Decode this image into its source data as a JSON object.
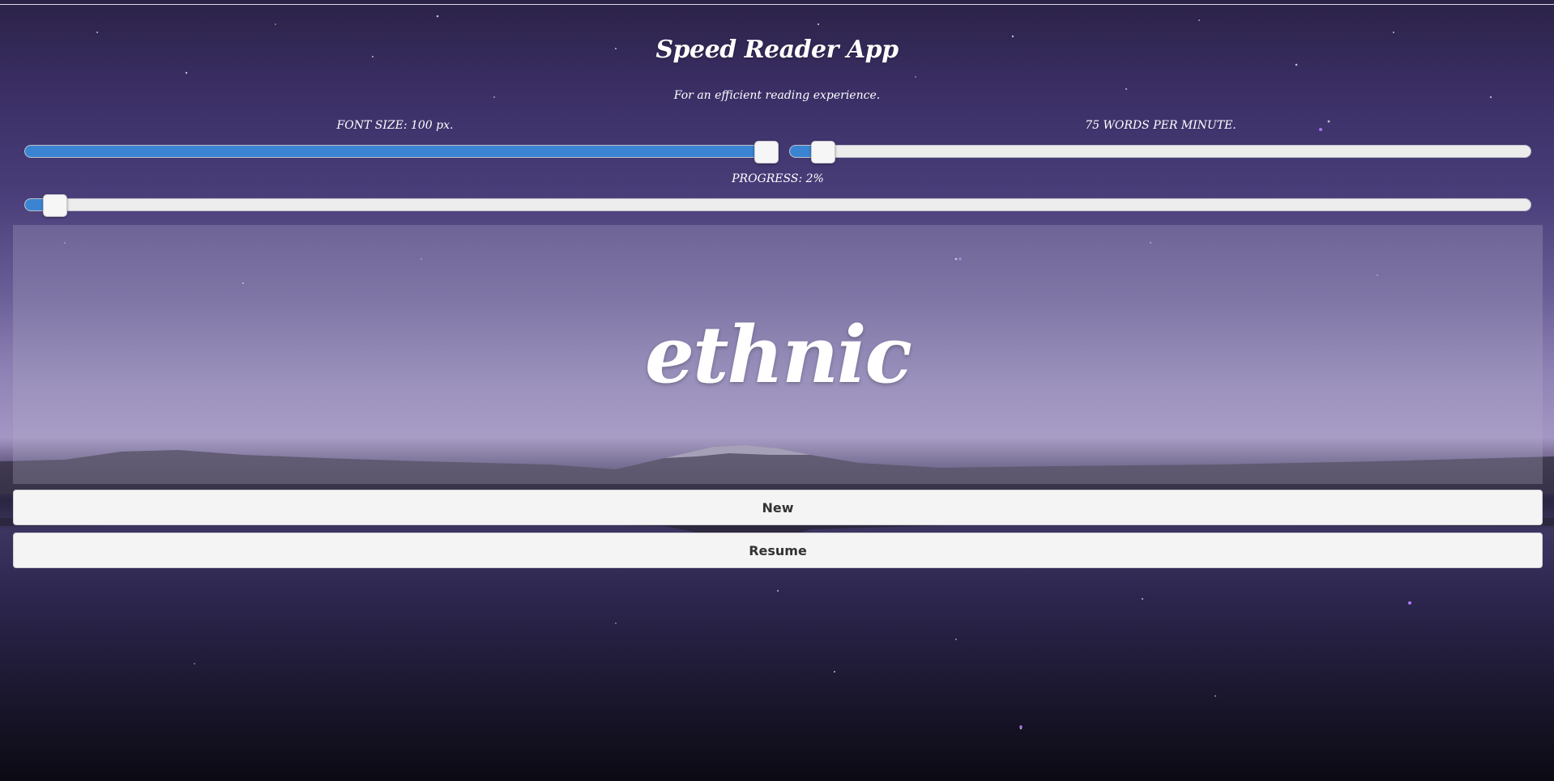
{
  "app": {
    "title": "Speed Reader App",
    "subtitle": "For an efficient reading experience."
  },
  "controls": {
    "font_size_label": "FONT SIZE: 100 px.",
    "font_size_fraction": 1.0,
    "wpm_label": "75 WORDS PER MINUTE.",
    "wpm_fraction": 0.045,
    "progress_label": "PROGRESS: 2%",
    "progress_fraction": 0.02
  },
  "reader": {
    "current_word": "ethnic"
  },
  "buttons": {
    "new_label": "New",
    "resume_label": "Resume"
  },
  "colors": {
    "accent": "#3a84d2",
    "track": "#ececec",
    "button_bg": "#f4f4f4"
  }
}
